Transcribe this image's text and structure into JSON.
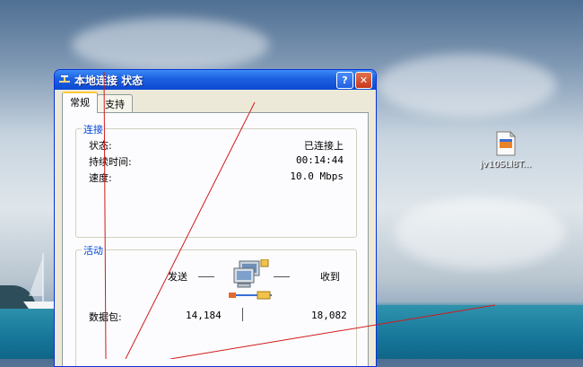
{
  "window": {
    "title": "本地连接 状态",
    "help_button": "?",
    "close_button": "✕",
    "tabs": [
      {
        "label": "常规",
        "active": true
      },
      {
        "label": "支持",
        "active": false
      }
    ]
  },
  "connection": {
    "legend": "连接",
    "rows": [
      {
        "label": "状态:",
        "value": "已连接上"
      },
      {
        "label": "持续时间:",
        "value": "00:14:44"
      },
      {
        "label": "速度:",
        "value": "10.0 Mbps"
      }
    ]
  },
  "activity": {
    "legend": "活动",
    "sent_label": "发送",
    "received_label": "收到",
    "packets_label": "数据包:",
    "packets_sent": "14,184",
    "packets_received": "18,082"
  },
  "desktop_icon": {
    "label": "jv10SLl8T..."
  },
  "colors": {
    "titlebar": "#0b49d4",
    "legend": "#0046d5",
    "tab_highlight": "#ffc73c",
    "annotation_line": "#d21a1a"
  }
}
